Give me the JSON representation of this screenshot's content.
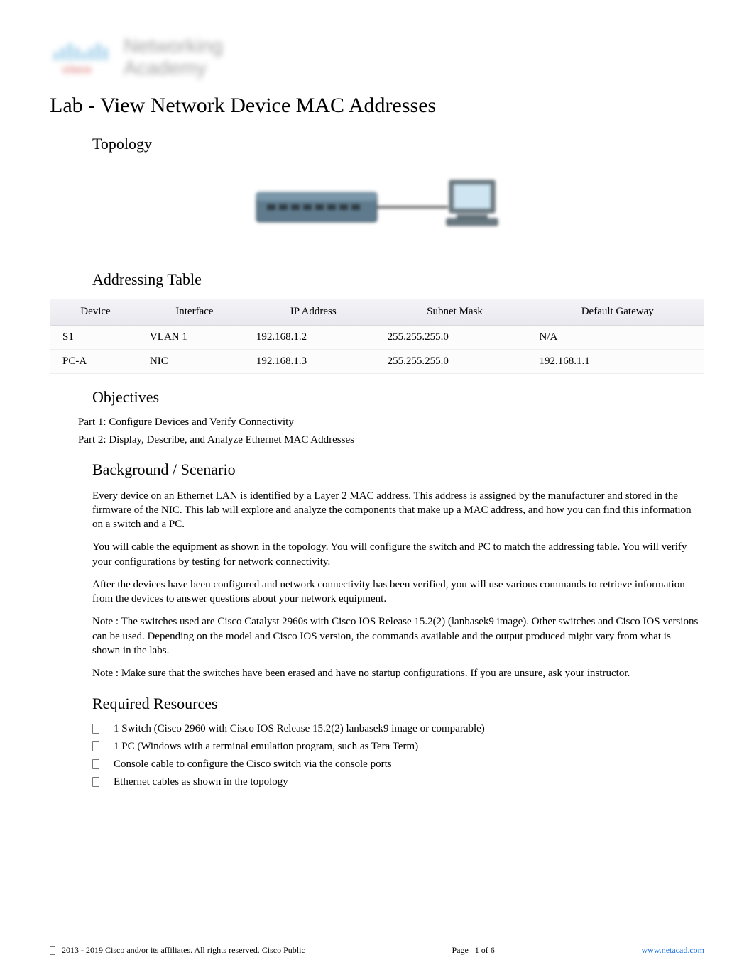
{
  "logo": {
    "line1": "Networking",
    "line2": "Academy",
    "brand": "cisco"
  },
  "title": "Lab - View Network Device MAC Addresses",
  "sections": {
    "topology": "Topology",
    "addressing": "Addressing Table",
    "objectives": "Objectives",
    "background": "Background / Scenario",
    "resources": "Required Resources"
  },
  "addressing_table": {
    "headers": {
      "device": "Device",
      "interface": "Interface",
      "ip": "IP Address",
      "subnet": "Subnet Mask",
      "gateway": "Default Gateway"
    },
    "rows": [
      {
        "device": "S1",
        "interface": "VLAN 1",
        "ip": "192.168.1.2",
        "subnet": "255.255.255.0",
        "gateway": "N/A"
      },
      {
        "device": "PC-A",
        "interface": "NIC",
        "ip": "192.168.1.3",
        "subnet": "255.255.255.0",
        "gateway": "192.168.1.1"
      }
    ]
  },
  "objectives": {
    "part1": "Part 1: Configure Devices and Verify Connectivity",
    "part2": "Part 2: Display, Describe, and Analyze Ethernet MAC Addresses"
  },
  "background_paragraphs": {
    "p1": "Every device on an Ethernet LAN is identified by a Layer 2 MAC address. This address is assigned by the manufacturer and stored in the firmware of the NIC. This lab will explore and analyze the components that make up a MAC address, and how you can find this information on a switch and a PC.",
    "p2": "You will cable the equipment as shown in the topology. You will configure the switch and PC to match the addressing table. You will verify your configurations by testing for network connectivity.",
    "p3": "After the devices have been configured and network connectivity has been verified, you will use various commands to retrieve information from the devices to answer questions about your network equipment.",
    "p4": "Note : The switches used are Cisco Catalyst 2960s with Cisco IOS Release 15.2(2) (lanbasek9 image). Other switches and Cisco IOS versions can be used. Depending on the model and Cisco IOS version, the commands available and the output produced might vary from what is shown in the labs.",
    "p5": "Note : Make sure that the switches have been erased and have no startup configurations. If you are unsure, ask your instructor."
  },
  "resources": {
    "r1": "1 Switch (Cisco 2960 with Cisco IOS Release 15.2(2) lanbasek9 image or comparable)",
    "r2": "1 PC (Windows with a terminal emulation program, such as Tera Term)",
    "r3": "Console cable to configure the Cisco switch via the console ports",
    "r4": "Ethernet cables as shown in the topology"
  },
  "footer": {
    "copyright": "2013 - 2019 Cisco and/or its affiliates. All rights reserved. Cisco Public",
    "page_label": "Page",
    "page_current": "1",
    "page_of": "of",
    "page_total": "6",
    "url": "www.netacad.com"
  }
}
